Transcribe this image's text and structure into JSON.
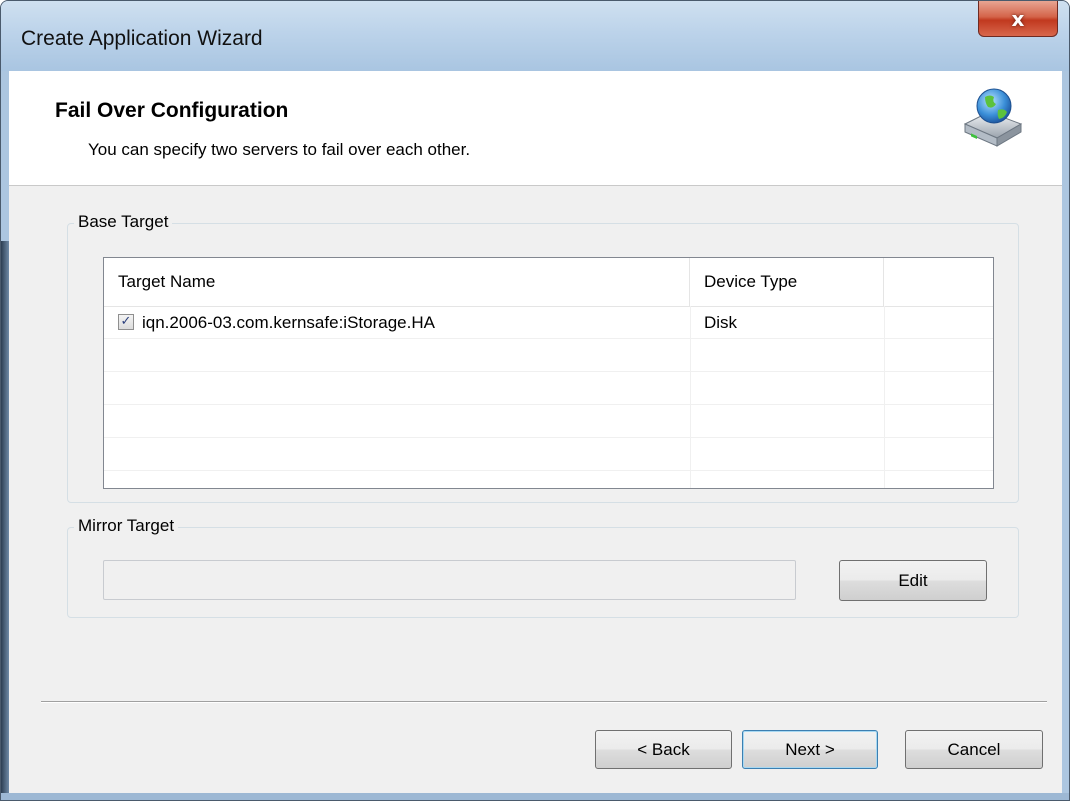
{
  "window": {
    "title": "Create Application Wizard",
    "close_glyph": "x"
  },
  "header": {
    "title": "Fail Over Configuration",
    "subtitle": "You can specify two servers to fail over each other.",
    "icon": "network-drive-globe-icon"
  },
  "base_target": {
    "label": "Base Target",
    "columns": [
      "Target Name",
      "Device Type",
      ""
    ],
    "rows": [
      {
        "checked": true,
        "target_name": "iqn.2006-03.com.kernsafe:iStorage.HA",
        "device_type": "Disk"
      }
    ]
  },
  "mirror_target": {
    "label": "Mirror Target",
    "value": "",
    "edit_label": "Edit"
  },
  "footer": {
    "back_label": "< Back",
    "next_label": "Next >",
    "cancel_label": "Cancel"
  },
  "colors": {
    "titlebar": "#bcd3ea",
    "client_background": "#f0f0f0",
    "close_button": "#c8462c",
    "checkmark": "#2b3f7c"
  }
}
